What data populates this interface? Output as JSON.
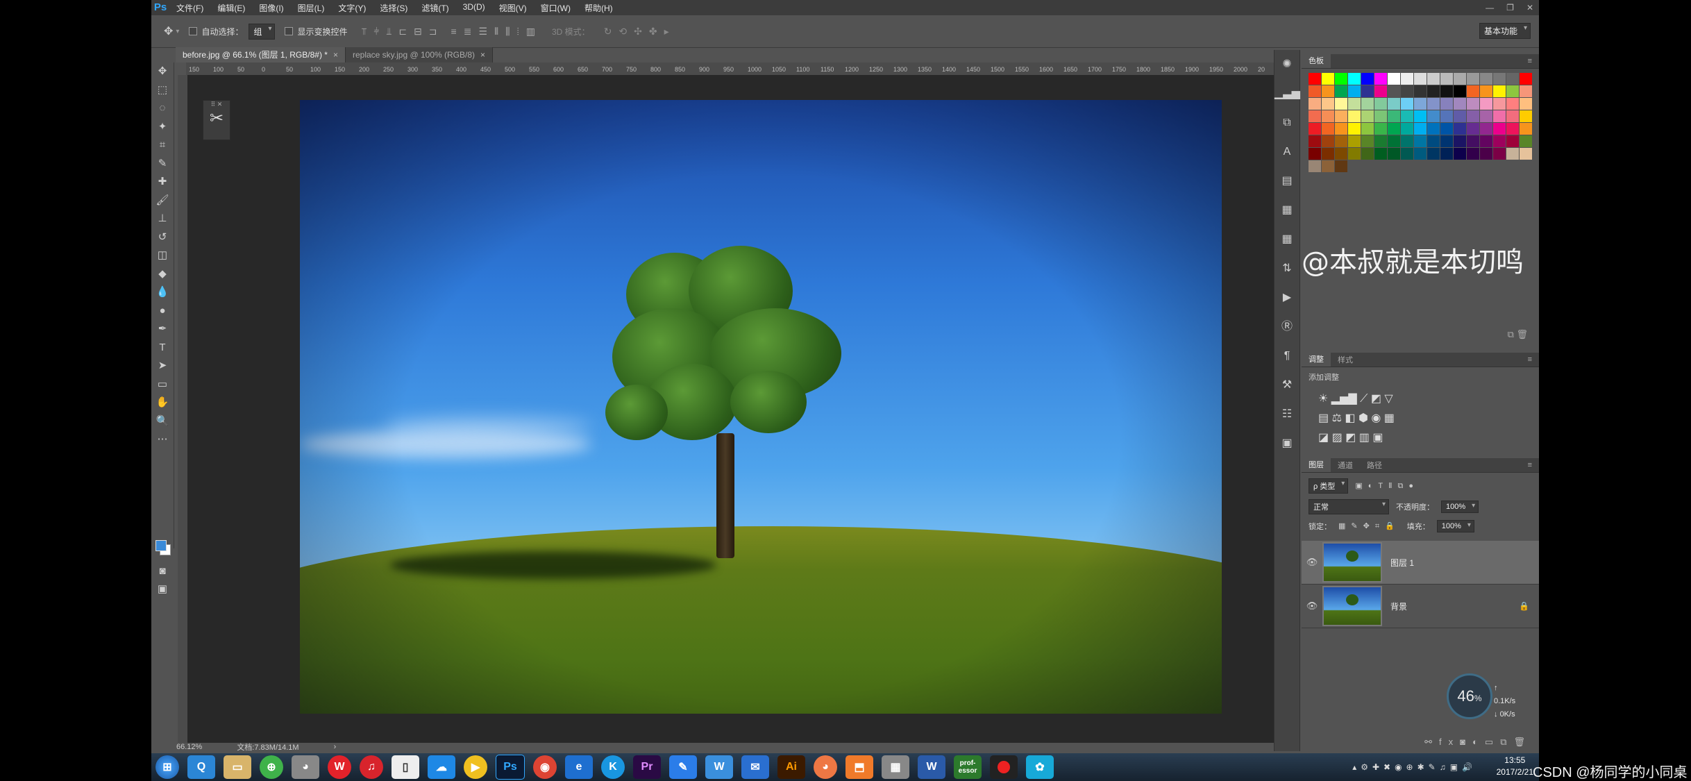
{
  "app": {
    "logo": "Ps"
  },
  "menu": [
    "文件(F)",
    "编辑(E)",
    "图像(I)",
    "图层(L)",
    "文字(Y)",
    "选择(S)",
    "滤镜(T)",
    "3D(D)",
    "视图(V)",
    "窗口(W)",
    "帮助(H)"
  ],
  "window_controls": {
    "minimize": "—",
    "restore": "❐",
    "close": "✕"
  },
  "options_bar": {
    "auto_select_label": "自动选择：",
    "auto_select_value": "组",
    "show_transform_label": "显示变换控件",
    "mode_3d_label": "3D 模式：",
    "workspace": "基本功能"
  },
  "tabs": [
    {
      "label": "before.jpg @ 66.1% (图层 1, RGB/8#) *",
      "close": "×"
    },
    {
      "label": "replace sky.jpg @ 100% (RGB/8)",
      "close": "×"
    }
  ],
  "ruler_ticks": [
    "150",
    "100",
    "50",
    "0",
    "50",
    "100",
    "150",
    "200",
    "250",
    "300",
    "350",
    "400",
    "450",
    "500",
    "550",
    "600",
    "650",
    "700",
    "750",
    "800",
    "850",
    "900",
    "950",
    "1000",
    "1050",
    "1100",
    "1150",
    "1200",
    "1250",
    "1300",
    "1350",
    "1400",
    "1450",
    "1500",
    "1550",
    "1600",
    "1650",
    "1700",
    "1750",
    "1800",
    "1850",
    "1900",
    "1950",
    "2000",
    "20"
  ],
  "status": {
    "zoom": "66.12%",
    "doc": "文档:7.83M/14.1M",
    "arrow": "›"
  },
  "swatches_panel": {
    "title": "色板"
  },
  "watermark": "@本叔就是本切鸣",
  "adjustments_panel": {
    "tabs": [
      "调整",
      "样式"
    ],
    "subtitle": "添加调整"
  },
  "layers_panel": {
    "tabs": [
      "图层",
      "通道",
      "路径"
    ],
    "filter_kind": "ρ 类型",
    "blend_mode": "正常",
    "opacity_label": "不透明度：",
    "opacity_value": "100%",
    "lock_label": "锁定：",
    "fill_label": "填充：",
    "fill_value": "100%",
    "layers": [
      {
        "name": "图层 1",
        "selected": true
      },
      {
        "name": "背景",
        "selected": false,
        "locked": true
      }
    ],
    "footer_icons": [
      "link-icon",
      "fx-icon",
      "mask-icon",
      "adjustment-icon",
      "folder-icon",
      "new-layer-icon",
      "trash-icon"
    ]
  },
  "net_speed": {
    "percent": "46",
    "unit": "%",
    "up": "0.1K/s",
    "down": "0K/s"
  },
  "taskbar": {
    "apps": [
      "start",
      "qq",
      "explorer",
      "360",
      "qq-penguin",
      "weibo",
      "netease-music",
      "file",
      "baidu-netdisk",
      "tencent-video",
      "photoshop",
      "chrome",
      "ie",
      "kugou",
      "premiere",
      "feather",
      "wps",
      "mail",
      "illustrator",
      "app2",
      "app3",
      "app4",
      "word",
      "professor",
      "recorder",
      "app5"
    ],
    "professor_label": "prof-essor",
    "clock_time": "13:55",
    "clock_date": "2017/2/21"
  },
  "csdn_watermark": "CSDN @杨同学的小同桌",
  "colors": {
    "ps_blue": "#31a8ff",
    "panel_bg": "#535353",
    "canvas_bg": "#282828"
  }
}
